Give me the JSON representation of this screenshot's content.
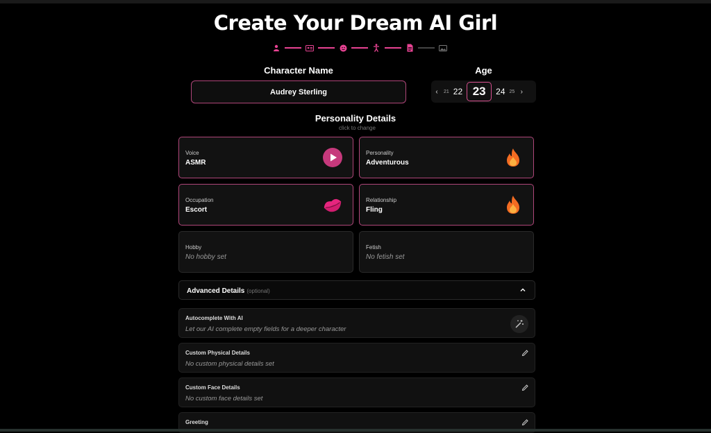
{
  "page": {
    "title": "Create Your Dream AI Girl"
  },
  "steps": [
    {
      "icon": "person-icon",
      "active": true
    },
    {
      "icon": "id-card-icon",
      "active": true
    },
    {
      "icon": "smiley-icon",
      "active": true
    },
    {
      "icon": "body-icon",
      "active": true
    },
    {
      "icon": "document-icon",
      "active": true
    },
    {
      "icon": "image-icon",
      "active": false
    }
  ],
  "character": {
    "label": "Character Name",
    "value": "Audrey Sterling"
  },
  "age": {
    "label": "Age",
    "options": [
      "21",
      "22",
      "23",
      "24",
      "25"
    ],
    "selected": "23"
  },
  "personality": {
    "title": "Personality Details",
    "subtitle": "click to change",
    "cards": [
      {
        "label": "Voice",
        "value": "ASMR",
        "icon": "play-icon"
      },
      {
        "label": "Personality",
        "value": "Adventurous",
        "icon": "fire-icon"
      },
      {
        "label": "Occupation",
        "value": "Escort",
        "icon": "kiss-lips-icon"
      },
      {
        "label": "Relationship",
        "value": "Fling",
        "icon": "fire-icon"
      },
      {
        "label": "Hobby",
        "value": "No hobby set"
      },
      {
        "label": "Fetish",
        "value": "No fetish set"
      }
    ]
  },
  "advanced": {
    "title": "Advanced Details",
    "optional": "(optional)",
    "rows": [
      {
        "label": "Autocomplete With AI",
        "value": "Let our AI complete empty fields for a deeper character",
        "icon": "magic-wand-icon"
      },
      {
        "label": "Custom Physical Details",
        "value": "No custom physical details set",
        "icon": "pencil-icon"
      },
      {
        "label": "Custom Face Details",
        "value": "No custom face details set",
        "icon": "pencil-icon"
      },
      {
        "label": "Greeting",
        "value": "",
        "icon": "pencil-icon"
      }
    ]
  },
  "colors": {
    "accent": "#e84393",
    "border_active": "#b0467a",
    "background": "#000000",
    "card": "#121212"
  }
}
